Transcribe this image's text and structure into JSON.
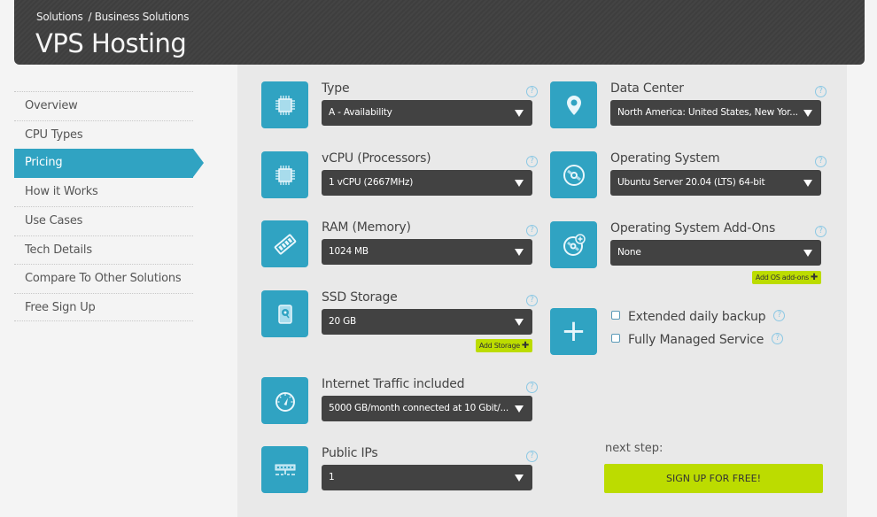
{
  "header": {
    "breadcrumb": [
      "Solutions",
      "/ Business Solutions"
    ],
    "title": "VPS Hosting"
  },
  "sidebar": {
    "items": [
      {
        "label": "Overview",
        "active": false
      },
      {
        "label": "CPU Types",
        "active": false
      },
      {
        "label": "Pricing",
        "active": true
      },
      {
        "label": "How it Works",
        "active": false
      },
      {
        "label": "Use Cases",
        "active": false
      },
      {
        "label": "Tech Details",
        "active": false
      },
      {
        "label": "Compare To Other Solutions",
        "active": false
      },
      {
        "label": "Free Sign Up",
        "active": false
      }
    ]
  },
  "config": {
    "help_glyph": "?",
    "type": {
      "label": "Type",
      "value": "A - Availability",
      "icon": "cpu-icon"
    },
    "vcpu": {
      "label": "vCPU (Processors)",
      "value": "1 vCPU (2667MHz)",
      "icon": "cpu-icon"
    },
    "ram": {
      "label": "RAM (Memory)",
      "value": "1024 MB",
      "icon": "ram-icon"
    },
    "ssd": {
      "label": "SSD Storage",
      "value": "20 GB",
      "icon": "hard-drive-icon",
      "add_label": "Add Storage"
    },
    "traffic": {
      "label": "Internet Traffic included",
      "value": "5000 GB/month connected at 10 Gbit/...",
      "icon": "speedometer-icon"
    },
    "ips": {
      "label": "Public IPs",
      "value": "1",
      "icon": "ip-address-icon"
    },
    "datacenter": {
      "label": "Data Center",
      "value": "North America: United States, New Yor...",
      "icon": "map-pin-icon"
    },
    "os": {
      "label": "Operating System",
      "value": "Ubuntu Server 20.04 (LTS) 64-bit",
      "icon": "disc-icon"
    },
    "os_addons": {
      "label": "Operating System Add-Ons",
      "value": "None",
      "icon": "disc-plus-icon",
      "add_label": "Add OS add-ons"
    },
    "extras": [
      {
        "label": "Extended daily backup",
        "checked": false
      },
      {
        "label": "Fully Managed Service",
        "checked": false
      }
    ],
    "plus_glyph": "+",
    "add_glyph": "✚"
  },
  "cta": {
    "next_label": "next step:",
    "signup_label": "SIGN UP FOR FREE!"
  },
  "colors": {
    "accent": "#30a3c2",
    "cta": "#bcdc00",
    "select_bg": "#424242",
    "header_bg": "#424242"
  }
}
